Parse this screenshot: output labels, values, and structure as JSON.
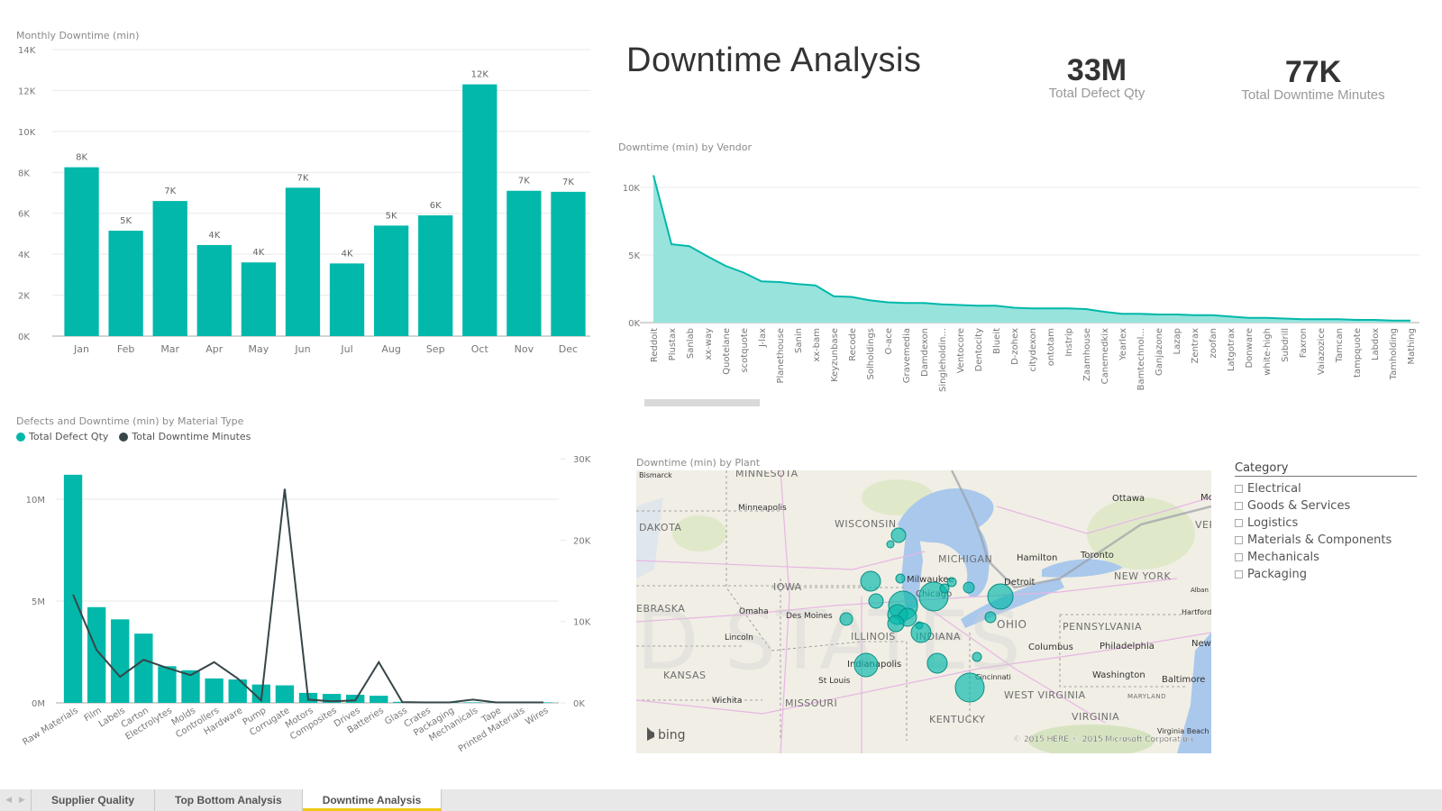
{
  "colors": {
    "teal": "#01b8aa",
    "teal_area": "#99e3dd",
    "dark_line": "#374649",
    "gridline": "#e9e9e9",
    "tab_active_underline": "#f2c811"
  },
  "header": {
    "title": "Downtime Analysis",
    "kpis": [
      {
        "value": "33M",
        "label": "Total Defect Qty"
      },
      {
        "value": "77K",
        "label": "Total Downtime Minutes"
      }
    ]
  },
  "chart_data": [
    {
      "id": "monthly",
      "type": "bar",
      "title": "Monthly Downtime (min)",
      "xlabel": "",
      "ylabel": "",
      "categories": [
        "Jan",
        "Feb",
        "Mar",
        "Apr",
        "May",
        "Jun",
        "Jul",
        "Aug",
        "Sep",
        "Oct",
        "Nov",
        "Dec"
      ],
      "values": [
        8250,
        5150,
        6600,
        4450,
        3600,
        7250,
        3550,
        5400,
        5900,
        12300,
        7100,
        7050
      ],
      "data_labels": [
        "8K",
        "5K",
        "7K",
        "4K",
        "4K",
        "7K",
        "4K",
        "5K",
        "6K",
        "12K",
        "7K",
        "7K"
      ],
      "ylim": [
        0,
        14000
      ],
      "yticks": [
        0,
        2000,
        4000,
        6000,
        8000,
        10000,
        12000,
        14000
      ],
      "ytick_labels": [
        "0K",
        "2K",
        "4K",
        "6K",
        "8K",
        "10K",
        "12K",
        "14K"
      ],
      "grid": true
    },
    {
      "id": "vendor",
      "type": "area",
      "title": "Downtime (min) by Vendor",
      "categories": [
        "Reddoit",
        "Plustax",
        "Sanlab",
        "xx-way",
        "Quotelane",
        "scotquote",
        "J-lax",
        "Planethouse",
        "Sanin",
        "xx-bam",
        "Keyzunbase",
        "Recode",
        "Solholdings",
        "O-ace",
        "Gravemedia",
        "Damdexon",
        "Singleholdin...",
        "Ventocore",
        "Dentocity",
        "Blueit",
        "D-zohex",
        "citydexon",
        "ontotam",
        "Instrip",
        "Zaamhouse",
        "Canemedkix",
        "Yearlex",
        "Bamtechnol...",
        "Ganjazone",
        "Lazap",
        "Zentrax",
        "zoofan",
        "Latgotrax",
        "Donware",
        "white-high",
        "Subdrill",
        "Faxron",
        "Vaiazozice",
        "Tamcan",
        "tampquote",
        "Labdox",
        "Tamholding",
        "Mathing"
      ],
      "values": [
        10900,
        5800,
        5650,
        4900,
        4200,
        3700,
        3050,
        3000,
        2850,
        2750,
        1950,
        1900,
        1650,
        1500,
        1450,
        1450,
        1350,
        1300,
        1250,
        1250,
        1100,
        1050,
        1050,
        1050,
        1000,
        800,
        650,
        650,
        600,
        600,
        550,
        550,
        450,
        350,
        350,
        300,
        250,
        250,
        250,
        200,
        200,
        150,
        150
      ],
      "ylim": [
        0,
        11000
      ],
      "yticks": [
        0,
        5000,
        10000
      ],
      "ytick_labels": [
        "0K",
        "5K",
        "10K"
      ],
      "grid": true
    },
    {
      "id": "material",
      "type": "bar+line",
      "title": "Defects and Downtime (min) by Material Type",
      "legend": [
        "Total Defect Qty",
        "Total Downtime Minutes"
      ],
      "legend_position": "top-left",
      "categories": [
        "Raw Materials",
        "Film",
        "Labels",
        "Carton",
        "Electrolytes",
        "Molds",
        "Controllers",
        "Hardware",
        "Pump",
        "Corrugate",
        "Motors",
        "Composites",
        "Drives",
        "Batteries",
        "Glass",
        "Crates",
        "Packaging",
        "Mechanicals",
        "Tape",
        "Printed Materials",
        "Wires"
      ],
      "series": [
        {
          "name": "Total Defect Qty",
          "type": "bar",
          "axis": "left",
          "values": [
            11200000,
            4700000,
            4100000,
            3400000,
            1800000,
            1600000,
            1200000,
            1150000,
            900000,
            860000,
            490000,
            440000,
            400000,
            350000,
            50000,
            20000,
            10000,
            10000,
            5000,
            5000,
            5000
          ]
        },
        {
          "name": "Total Downtime Minutes",
          "type": "line",
          "axis": "right",
          "values": [
            13300,
            6500,
            3200,
            5300,
            4300,
            3400,
            5000,
            3000,
            300,
            26300,
            400,
            200,
            300,
            5000,
            100,
            50,
            50,
            400,
            50,
            50,
            50
          ]
        }
      ],
      "left_ylim": [
        0,
        12000000
      ],
      "left_yticks": [
        0,
        5000000,
        10000000
      ],
      "left_ytick_labels": [
        "0M",
        "5M",
        "10M"
      ],
      "right_ylim": [
        0,
        30000
      ],
      "right_yticks": [
        0,
        10000,
        20000,
        30000
      ],
      "right_ytick_labels": [
        "0K",
        "10K",
        "20K",
        "30K"
      ],
      "grid": true
    }
  ],
  "map": {
    "title": "Downtime (min) by Plant",
    "labels": {
      "states": [
        "MINNESOTA",
        "WISCONSIN",
        "DAKOTA",
        "IOWA",
        "EBRASKA",
        "ILLINOIS",
        "INDIANA",
        "OHIO",
        "KANSAS",
        "MISSOURI",
        "MICHIGAN",
        "NEW YORK",
        "PENNSYLVANIA",
        "WEST VIRGINIA",
        "KENTUCKY",
        "VIRGINIA",
        "MARYLAND",
        "VERM"
      ],
      "cities": [
        "Bismarck",
        "Minneapolis",
        "Omaha",
        "Des Moines",
        "Lincoln",
        "Wichita",
        "St Louis",
        "Indianapolis",
        "Milwaukee",
        "Chicago",
        "Detroit",
        "Hamilton",
        "Toronto",
        "Ottawa",
        "Columbus",
        "Cincinnati",
        "Philadelphia",
        "Washington",
        "Baltimore",
        "Hartford",
        "New",
        "Alban",
        "Mo",
        "Virginia Beach"
      ]
    },
    "brand": "bing",
    "copyright": "© 2015 HERE   © 2015 Microsoft Corporation",
    "watermark": "D STATES"
  },
  "slicer": {
    "header": "Category",
    "items": [
      "Electrical",
      "Goods & Services",
      "Logistics",
      "Materials & Components",
      "Mechanicals",
      "Packaging"
    ]
  },
  "tabs": {
    "items": [
      {
        "label": "Supplier Quality",
        "active": false
      },
      {
        "label": "Top Bottom Analysis",
        "active": false
      },
      {
        "label": "Downtime Analysis",
        "active": true
      }
    ],
    "prev_icon": "◀",
    "next_icon": "▶"
  }
}
